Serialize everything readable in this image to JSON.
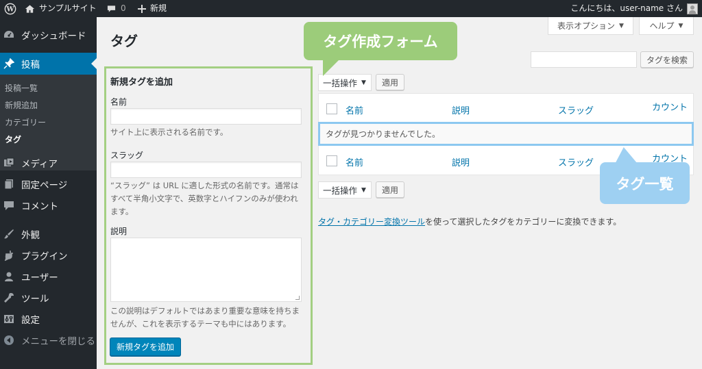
{
  "admin_bar": {
    "site_name": "サンプルサイト",
    "comment_count": "0",
    "new_label": "新規",
    "greeting": "こんにちは、user-name さん"
  },
  "sidebar": {
    "items": [
      {
        "label": "ダッシュボード",
        "icon": "dashboard-icon"
      },
      {
        "label": "投稿",
        "icon": "pin-icon"
      },
      {
        "label": "メディア",
        "icon": "media-icon"
      },
      {
        "label": "固定ページ",
        "icon": "page-icon"
      },
      {
        "label": "コメント",
        "icon": "comment-icon"
      },
      {
        "label": "外観",
        "icon": "brush-icon"
      },
      {
        "label": "プラグイン",
        "icon": "plugin-icon"
      },
      {
        "label": "ユーザー",
        "icon": "user-icon"
      },
      {
        "label": "ツール",
        "icon": "wrench-icon"
      },
      {
        "label": "設定",
        "icon": "settings-icon"
      }
    ],
    "submenu": [
      "投稿一覧",
      "新規追加",
      "カテゴリー",
      "タグ"
    ],
    "collapse_label": "メニューを閉じる"
  },
  "page": {
    "title": "タグ",
    "screen_options": "表示オプション",
    "help": "ヘルプ"
  },
  "search": {
    "button": "タグを検索"
  },
  "form": {
    "heading": "新規タグを追加",
    "name_label": "名前",
    "name_desc": "サイト上に表示される名前です。",
    "slug_label": "スラッグ",
    "slug_desc": "“スラッグ” は URL に適した形式の名前です。通常はすべて半角小文字で、英数字とハイフンのみが使われます。",
    "desc_label": "説明",
    "desc_desc": "この説明はデフォルトではあまり重要な意味を持ちませんが、これを表示するテーマも中にはあります。",
    "submit": "新規タグを追加"
  },
  "table": {
    "bulk_action": "一括操作",
    "apply": "適用",
    "columns": [
      "名前",
      "説明",
      "スラッグ",
      "カウント"
    ],
    "empty_message": "タグが見つかりませんでした。"
  },
  "footer_text": {
    "link": "タグ・カテゴリー変換ツール",
    "rest": "を使って選択したタグをカテゴリーに変換できます。"
  },
  "callouts": {
    "form": "タグ作成フォーム",
    "list": "タグ一覧"
  },
  "colors": {
    "admin_bar_bg": "#23282d",
    "accent": "#0073aa",
    "form_highlight": "#a3cf82",
    "list_highlight": "#8cc8f0"
  }
}
